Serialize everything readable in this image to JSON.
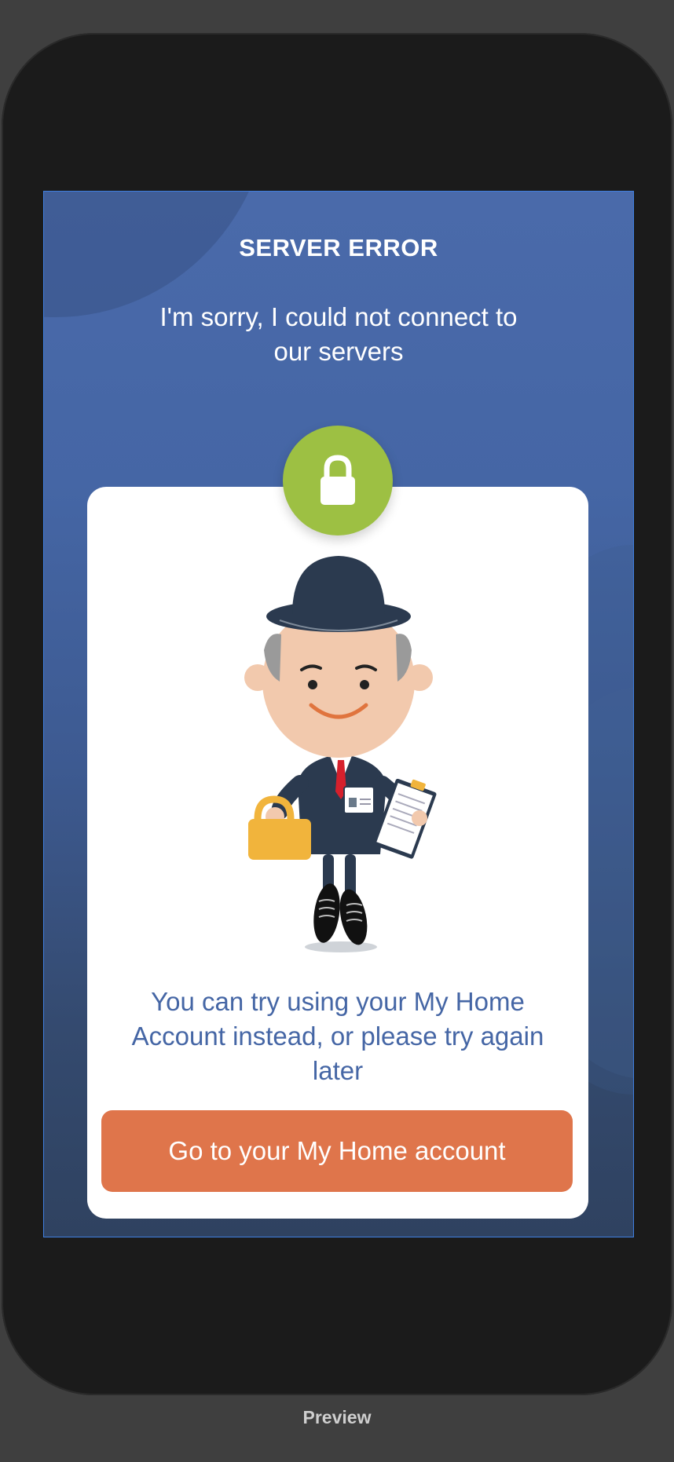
{
  "screen": {
    "title": "SERVER ERROR",
    "message": "I'm sorry, I could not connect to our servers"
  },
  "card": {
    "badge_icon": "lock-icon",
    "illustration": "bowler-hat-man-with-padlock-and-clipboard",
    "body_text": "You can try using your My Home Account instead, or please try again later",
    "button_label": "Go to your My Home account"
  },
  "footer": {
    "preview_label": "Preview"
  },
  "colors": {
    "background_top": "#4a6aaa",
    "background_bottom": "#2f4260",
    "badge_green": "#9dc043",
    "button_orange": "#df754b",
    "body_text_blue": "#4566a5"
  }
}
